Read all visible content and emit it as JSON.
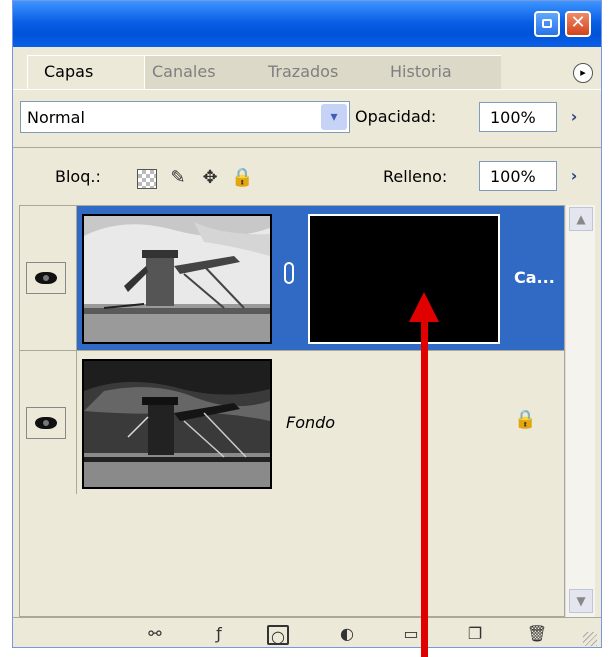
{
  "window": {
    "minimize_label": "",
    "close_label": "✕"
  },
  "tabs": [
    {
      "label": "Capas",
      "active": true
    },
    {
      "label": "Canales",
      "active": false
    },
    {
      "label": "Trazados",
      "active": false
    },
    {
      "label": "Historia",
      "active": false
    }
  ],
  "panel_menu_glyph": "▸",
  "blend_mode": {
    "value": "Normal",
    "arrow": "▾"
  },
  "opacity": {
    "label": "Opacidad:",
    "value": "100%",
    "arrow": "›"
  },
  "lock": {
    "label": "Bloq.:",
    "icons": [
      "transparency-lock-icon",
      "brush-lock-icon",
      "move-lock-icon",
      "padlock-icon"
    ]
  },
  "fill": {
    "label": "Relleno:",
    "value": "100%",
    "arrow": "›"
  },
  "layers": [
    {
      "name": "Ca...",
      "selected": true,
      "visible": true,
      "has_mask": true,
      "italic": false,
      "locked": false
    },
    {
      "name": "Fondo",
      "selected": false,
      "visible": true,
      "has_mask": false,
      "italic": true,
      "locked": true
    }
  ],
  "bottom_icons": [
    "link-icon",
    "layer-style-icon",
    "mask-icon",
    "adjustment-icon",
    "folder-icon",
    "new-layer-icon",
    "trash-icon"
  ],
  "colors": {
    "titlebar": "#0a5fe6",
    "selection": "#316ac5",
    "panel": "#ece9d8",
    "annotation_arrow": "#e00000"
  }
}
